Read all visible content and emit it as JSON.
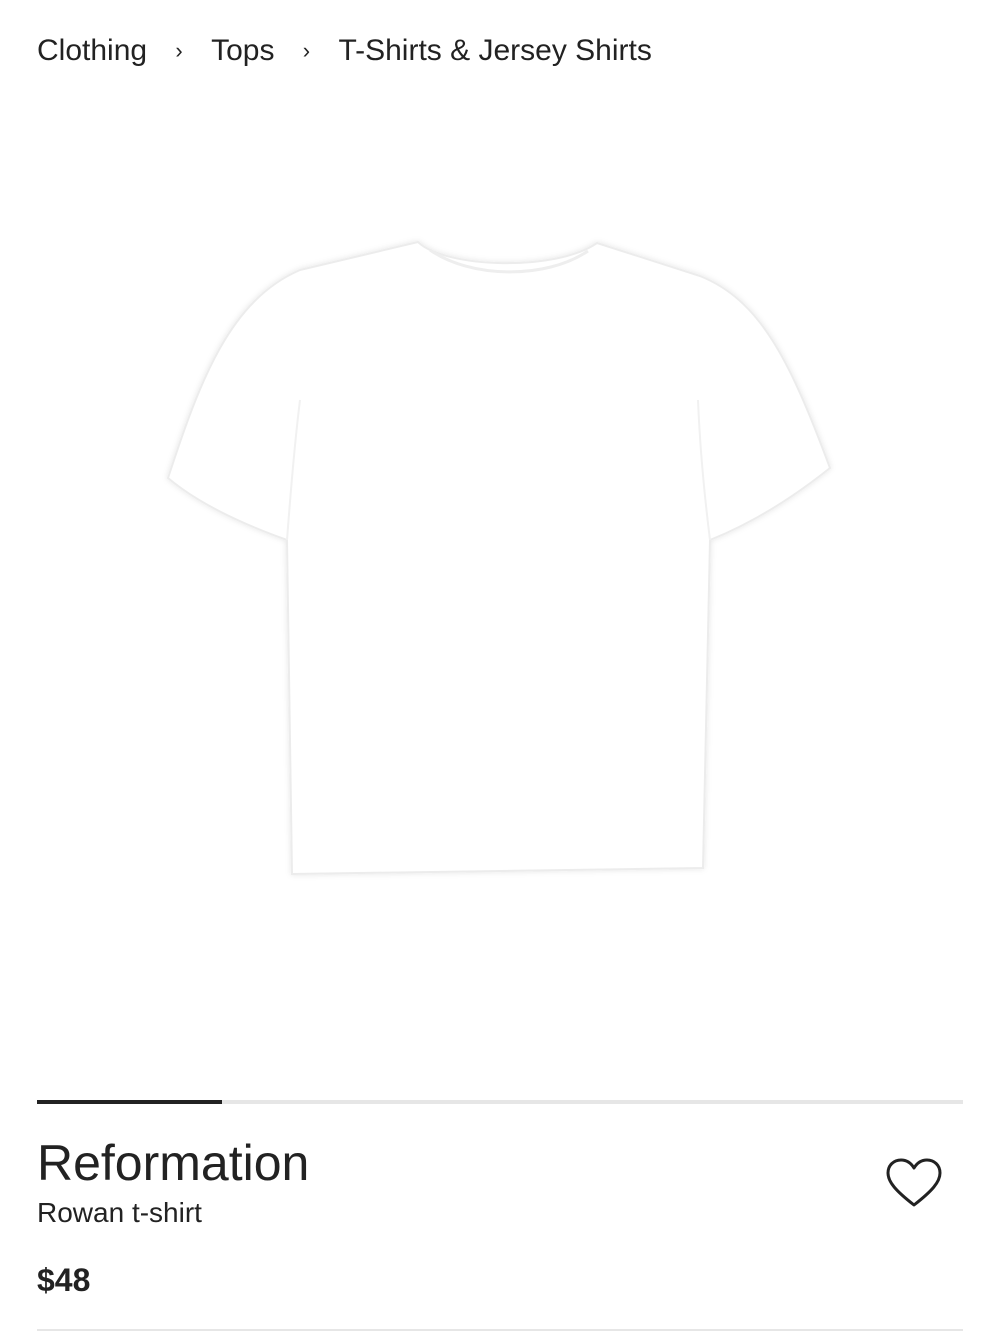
{
  "breadcrumb": {
    "items": [
      "Clothing",
      "Tops",
      "T-Shirts & Jersey Shirts"
    ],
    "separator": "›"
  },
  "product": {
    "brand": "Reformation",
    "name": "Rowan t-shirt",
    "price": "$48",
    "image_icon": "white-tshirt-image"
  },
  "carousel": {
    "progress": 0.2
  },
  "icons": {
    "wishlist": "heart-outline-icon"
  },
  "colors": {
    "text": "#222222",
    "track": "#e6e6e6",
    "shirt": "#ffffff"
  }
}
